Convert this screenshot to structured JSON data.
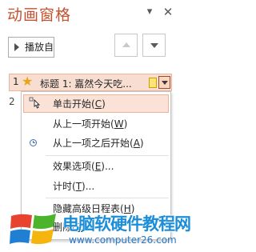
{
  "pane": {
    "title": "动画窗格",
    "dropdown_icon": "chevron-down-icon",
    "close_icon": "close-icon"
  },
  "toolbar": {
    "play_label": "播放自",
    "move_up_icon": "triangle-up-icon",
    "move_down_icon": "triangle-down-icon"
  },
  "animations": [
    {
      "index": "1",
      "effect_icon": "star-icon",
      "label": "标题 1: 嘉然今天吃..."
    },
    {
      "index": "2"
    }
  ],
  "context_menu": {
    "items": [
      {
        "prefix": "单击开始(",
        "key": "C",
        "suffix": ")",
        "icon": "mouse-cursor-icon",
        "highlighted": true
      },
      {
        "prefix": "从上一项开始(",
        "key": "W",
        "suffix": ")"
      },
      {
        "prefix": "从上一项之后开始(",
        "key": "A",
        "suffix": ")",
        "icon": "clock-icon"
      },
      {
        "prefix": "效果选项(",
        "key": "E",
        "suffix": ")..."
      },
      {
        "prefix": "计时(",
        "key": "T",
        "suffix": ")..."
      },
      {
        "prefix": "隐藏高级日程表(",
        "key": "H",
        "suffix": ")"
      },
      {
        "prefix": "删除(",
        "key": "R",
        "suffix": ")"
      }
    ]
  },
  "watermark": {
    "title": "电脑软硬件教程网",
    "url": "www.computer26.com"
  },
  "colors": {
    "title": "#c3522e",
    "highlight_bg": "#fbe2d7",
    "row_bg": "#f8ddd1",
    "watermark": "#1c8ed8"
  }
}
